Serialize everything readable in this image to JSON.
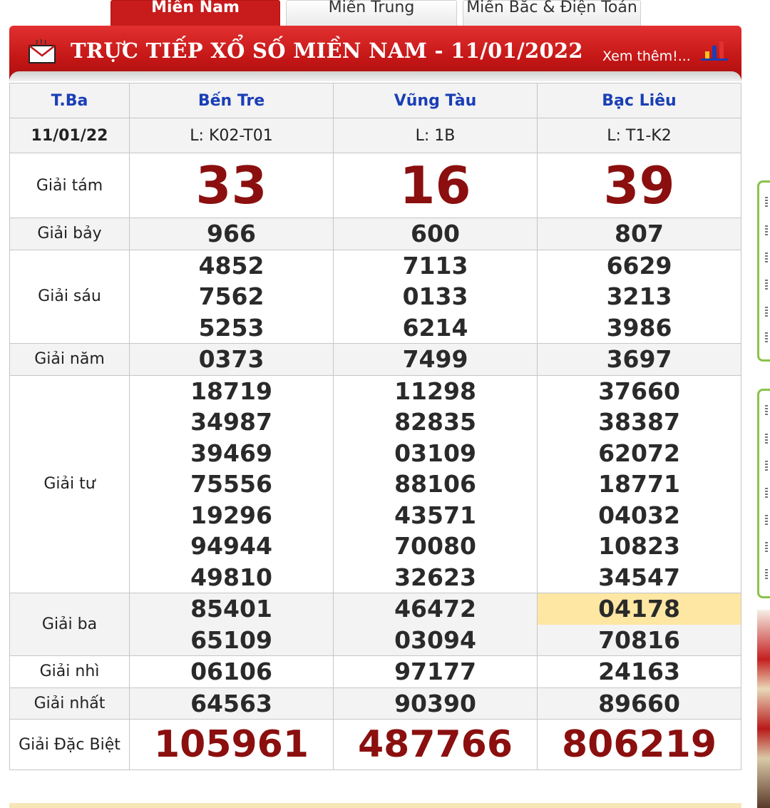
{
  "tabs": [
    {
      "label": "Miền Nam",
      "active": true
    },
    {
      "label": "Miền Trung",
      "active": false
    },
    {
      "label": "Miền Bắc & Điện Toán",
      "active": false
    }
  ],
  "header": {
    "title": "TRỰC TIẾP XỔ SỐ MIỀN NAM - 11/01/2022",
    "see_more": "Xem thêm!...",
    "icons": [
      "mail-icon",
      "bar-chart-icon"
    ]
  },
  "table": {
    "day": "T.Ba",
    "date": "11/01/22",
    "stations": [
      {
        "name": "Bến Tre",
        "code": "L: K02-T01"
      },
      {
        "name": "Vũng Tàu",
        "code": "L: 1B"
      },
      {
        "name": "Bạc Liêu",
        "code": "L: T1-K2"
      }
    ],
    "prizes": [
      {
        "label": "Giải tám",
        "values": [
          [
            "33"
          ],
          [
            "16"
          ],
          [
            "39"
          ]
        ]
      },
      {
        "label": "Giải bảy",
        "values": [
          [
            "966"
          ],
          [
            "600"
          ],
          [
            "807"
          ]
        ]
      },
      {
        "label": "Giải sáu",
        "values": [
          [
            "4852",
            "7562",
            "5253"
          ],
          [
            "7113",
            "0133",
            "6214"
          ],
          [
            "6629",
            "3213",
            "3986"
          ]
        ]
      },
      {
        "label": "Giải năm",
        "values": [
          [
            "0373"
          ],
          [
            "7499"
          ],
          [
            "3697"
          ]
        ]
      },
      {
        "label": "Giải tư",
        "values": [
          [
            "18719",
            "34987",
            "39469",
            "75556",
            "19296",
            "94944",
            "49810"
          ],
          [
            "11298",
            "82835",
            "03109",
            "88106",
            "43571",
            "70080",
            "32623"
          ],
          [
            "37660",
            "38387",
            "62072",
            "18771",
            "04032",
            "10823",
            "34547"
          ]
        ]
      },
      {
        "label": "Giải ba",
        "values": [
          [
            "85401",
            "65109"
          ],
          [
            "46472",
            "03094"
          ],
          [
            "04178",
            "70816"
          ]
        ]
      },
      {
        "label": "Giải nhì",
        "values": [
          [
            "06106"
          ],
          [
            "97177"
          ],
          [
            "24163"
          ]
        ]
      },
      {
        "label": "Giải nhất",
        "values": [
          [
            "64563"
          ],
          [
            "90390"
          ],
          [
            "89660"
          ]
        ]
      },
      {
        "label": "Giải Đặc Biệt",
        "values": [
          [
            "105961"
          ],
          [
            "487766"
          ],
          [
            "806219"
          ]
        ]
      }
    ],
    "highlight_color": "#fde7a3",
    "accent_color": "#c41616"
  }
}
